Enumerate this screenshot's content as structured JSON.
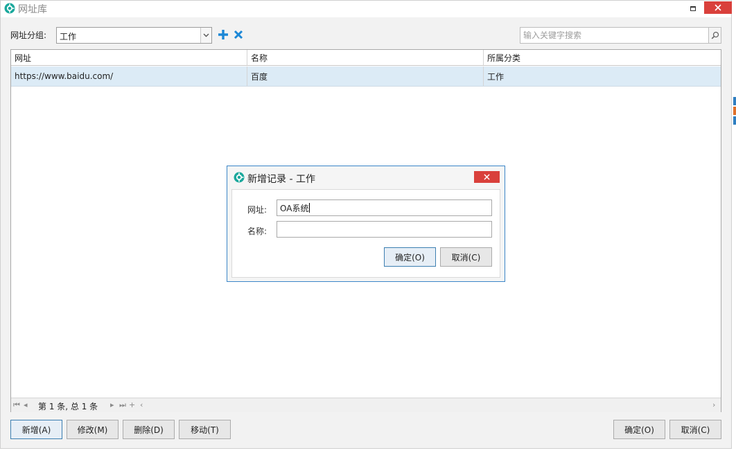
{
  "window": {
    "title": "网址库"
  },
  "toolbar": {
    "group_label": "网址分组:",
    "group_value": "工作",
    "search_placeholder": "输入关键字搜索"
  },
  "table": {
    "columns": [
      "网址",
      "名称",
      "所属分类"
    ],
    "rows": [
      [
        "https://www.baidu.com/",
        "百度",
        "工作"
      ]
    ]
  },
  "pager": {
    "info": "第 1 条, 总 1 条"
  },
  "buttons": {
    "add": "新增(A)",
    "edit": "修改(M)",
    "delete": "删除(D)",
    "move": "移动(T)",
    "ok": "确定(O)",
    "cancel": "取消(C)"
  },
  "dialog": {
    "title": "新增记录 - 工作",
    "url_label": "网址:",
    "url_value": "OA系统",
    "name_label": "名称:",
    "name_value": "",
    "ok": "确定(O)",
    "cancel": "取消(C)"
  },
  "colors": {
    "accent_blue": "#1c87d6",
    "close_red": "#d9403b",
    "logo_teal": "#1aa89c",
    "row_selected": "#dcebf6"
  },
  "icons": [
    "app-logo-icon",
    "maximize-icon",
    "close-icon",
    "chevron-down-icon",
    "plus-icon",
    "x-icon",
    "search-icon",
    "first-page-icon",
    "prev-page-icon",
    "next-page-icon",
    "last-page-icon"
  ]
}
